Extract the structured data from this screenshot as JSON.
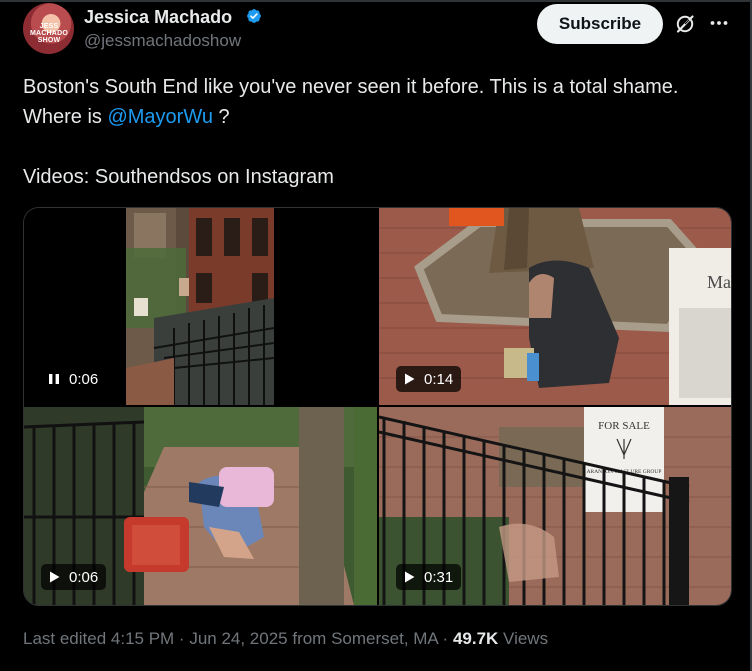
{
  "author": {
    "name": "Jessica Machado",
    "handle": "@jessmachadoshow",
    "avatar_text": "JESS MACHADO SHOW"
  },
  "actions": {
    "subscribe_label": "Subscribe"
  },
  "tweet": {
    "line1": "Boston's South End like you've never seen it before. This is a total shame.",
    "line2_prefix": "Where is ",
    "mention": "@MayorWu",
    "line2_suffix": " ?",
    "line3": "Videos: Southendsos on Instagram"
  },
  "media": [
    {
      "duration": "0:06",
      "state": "playing"
    },
    {
      "duration": "0:14",
      "state": "paused"
    },
    {
      "duration": "0:06",
      "state": "paused"
    },
    {
      "duration": "0:31",
      "state": "paused"
    }
  ],
  "sign_text": {
    "for_sale": "FOR SALE",
    "company": "ARANSON MACLURE GROUP",
    "street_sign": "Mac"
  },
  "footer": {
    "edited": "Last edited 4:15 PM · Jun 24, 2025 from Somerset, MA · ",
    "views_count": "49.7K",
    "views_label": " Views"
  },
  "colors": {
    "background": "#000000",
    "accent": "#1d9bf0",
    "muted": "#71767b",
    "text": "#e7e9ea"
  }
}
